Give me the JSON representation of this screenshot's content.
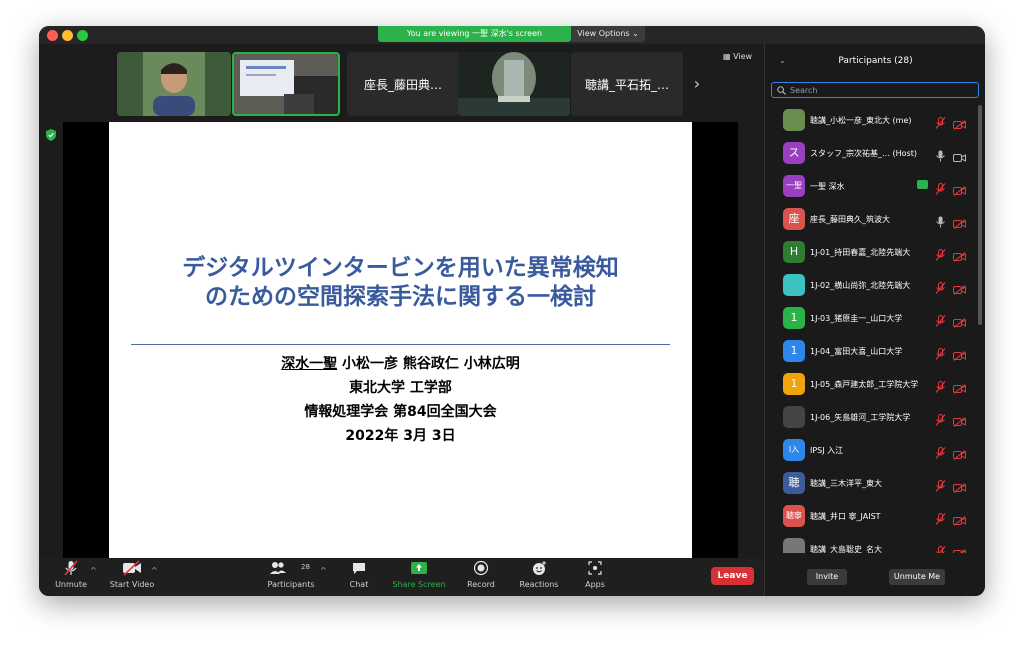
{
  "banner": {
    "viewing_text": "You are viewing 一聖 深水's screen",
    "view_options": "View Options ⌄"
  },
  "gallery": {
    "tiles": [
      {
        "type": "video",
        "name": ""
      },
      {
        "type": "video",
        "name": ""
      },
      {
        "type": "name",
        "name": "座長_藤田典…"
      },
      {
        "type": "video",
        "name": ""
      },
      {
        "type": "name",
        "name": "聴講_平石拓_…"
      }
    ],
    "next": "›",
    "view_label": "View"
  },
  "slide": {
    "title_line1": "デジタルツインタービンを用いた異常検知",
    "title_line2": "のための空間探索手法に関する一検討",
    "presenter": "深水一聖",
    "coauthors": " 小松一彦 熊谷政仁 小林広明",
    "affiliation": "東北大学 工学部",
    "conference": "情報処理学会 第84回全国大会",
    "date": "2022年 3月 3日"
  },
  "toolbar": {
    "unmute": "Unmute",
    "start_video": "Start Video",
    "participants": "Participants",
    "participants_count": "28",
    "chat": "Chat",
    "share_screen": "Share Screen",
    "record": "Record",
    "reactions": "Reactions",
    "apps": "Apps",
    "leave": "Leave"
  },
  "panel": {
    "title": "Participants (28)",
    "search_placeholder": "Search",
    "participants": [
      {
        "name": "聴講_小松一彦_東北大 (me)",
        "avatar_text": "",
        "avatar_color": "#6b8e4e",
        "mic": "muted",
        "cam": "off",
        "sharing": false
      },
      {
        "name": "スタッフ_宗次祐基_…   (Host)",
        "avatar_text": "ス",
        "avatar_color": "#9b3fc2",
        "mic": "on",
        "cam": "on",
        "sharing": false
      },
      {
        "name": "一聖 深水",
        "avatar_text": "一聖",
        "avatar_color": "#9b3fc2",
        "mic": "muted",
        "cam": "off",
        "sharing": true
      },
      {
        "name": "座長_藤田典久_筑波大",
        "avatar_text": "座",
        "avatar_color": "#d9534f",
        "mic": "on",
        "cam": "off",
        "sharing": false
      },
      {
        "name": "1J-01_持田春嘉_北陸先端大",
        "avatar_text": "H",
        "avatar_color": "#2e7d32",
        "mic": "muted",
        "cam": "off",
        "sharing": false
      },
      {
        "name": "1J-02_横山尚弥_北陸先端大",
        "avatar_text": "",
        "avatar_color": "#3cc0c0",
        "mic": "muted",
        "cam": "off",
        "sharing": false
      },
      {
        "name": "1J-03_猪原圭一_山口大学",
        "avatar_text": "1",
        "avatar_color": "#2cb24a",
        "mic": "muted",
        "cam": "off",
        "sharing": false
      },
      {
        "name": "1J-04_富田大喜_山口大学",
        "avatar_text": "1",
        "avatar_color": "#2e86ea",
        "mic": "muted",
        "cam": "off",
        "sharing": false
      },
      {
        "name": "1J-05_森戸建太郎_工学院大学",
        "avatar_text": "1",
        "avatar_color": "#f0a30a",
        "mic": "muted",
        "cam": "off",
        "sharing": false
      },
      {
        "name": "1J-06_矢島雄河_工学院大学",
        "avatar_text": "",
        "avatar_color": "#444444",
        "mic": "muted",
        "cam": "off",
        "sharing": false
      },
      {
        "name": "IPSJ 入江",
        "avatar_text": "I入",
        "avatar_color": "#2e86ea",
        "mic": "muted",
        "cam": "off",
        "sharing": false
      },
      {
        "name": "聴講_三木洋平_東大",
        "avatar_text": "聴",
        "avatar_color": "#3b5b9b",
        "mic": "muted",
        "cam": "off",
        "sharing": false
      },
      {
        "name": "聴講_井口 寧_JAIST",
        "avatar_text": "聴寧",
        "avatar_color": "#d9534f",
        "mic": "muted",
        "cam": "off",
        "sharing": false
      },
      {
        "name": "聴講_大島聡史_名大",
        "avatar_text": "",
        "avatar_color": "#777777",
        "mic": "muted",
        "cam": "off",
        "sharing": false
      }
    ],
    "invite": "Invite",
    "unmute_me": "Unmute Me"
  },
  "colors": {
    "accent_green": "#2cb24a",
    "leave_red": "#d83034",
    "muted_red": "#e0393e",
    "slide_title": "#3a5a9e",
    "search_border": "#2e86ea"
  }
}
